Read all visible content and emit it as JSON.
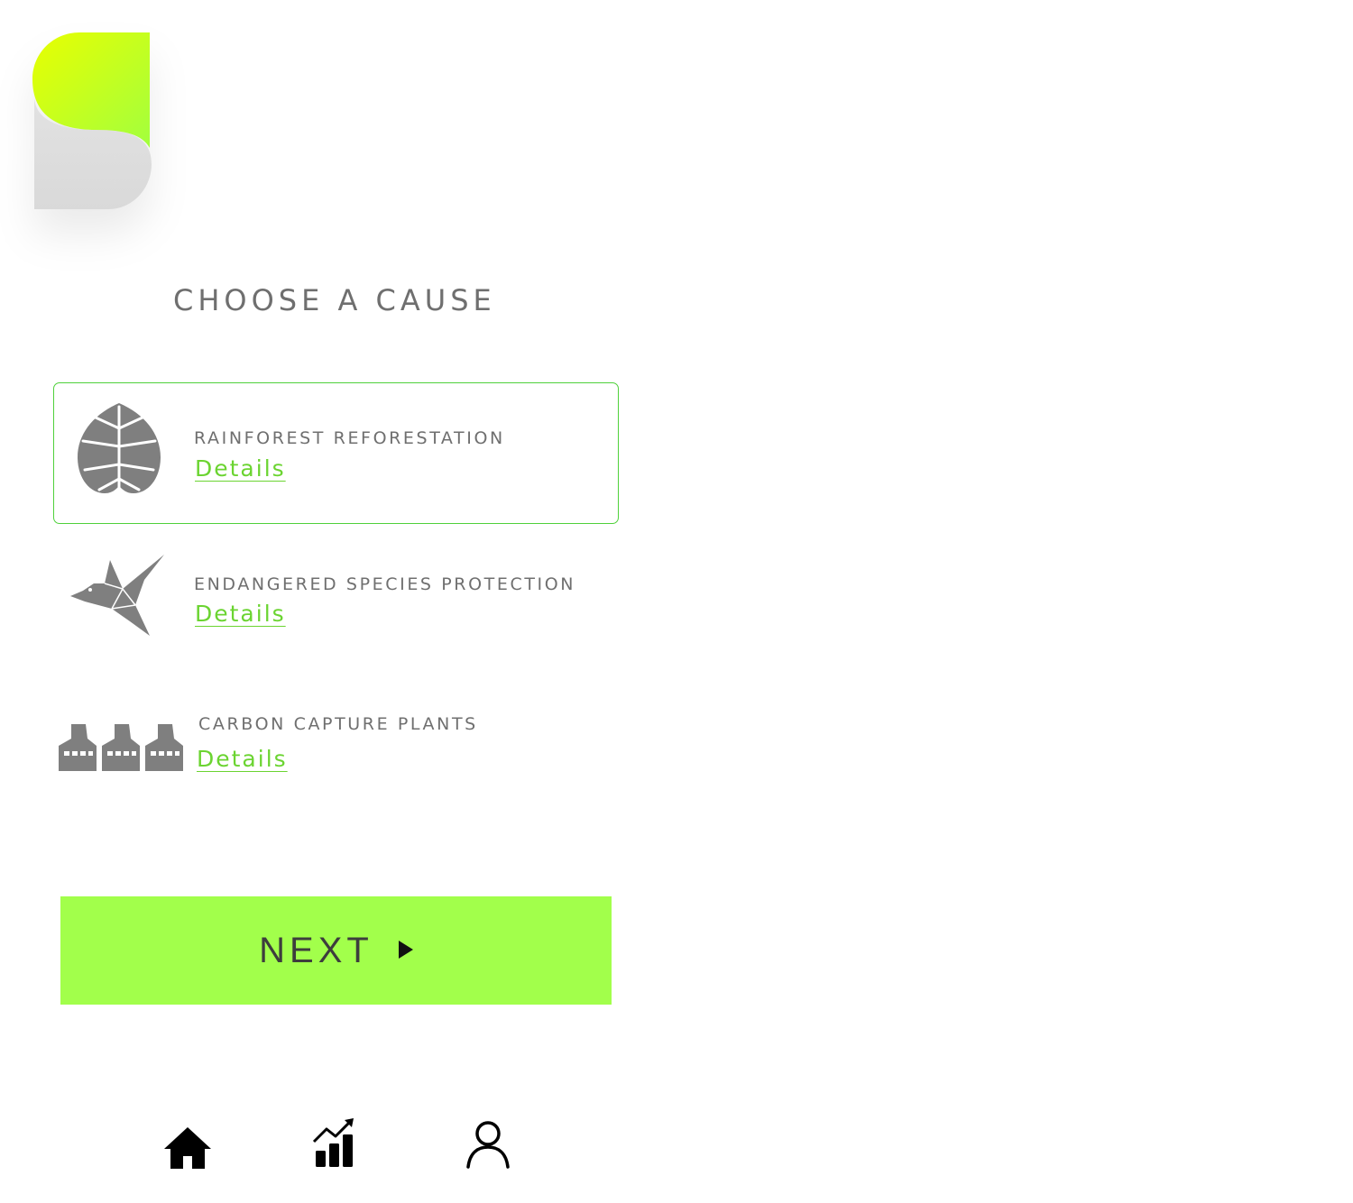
{
  "logo": {
    "icon": "brand-logo-icon",
    "gradient": [
      "#e5ff00",
      "#a6ff38"
    ],
    "base_color": "#dedede"
  },
  "page": {
    "title": "CHOOSE A CAUSE"
  },
  "causes": [
    {
      "name": "RAINFOREST REFORESTATION",
      "details_label": "Details",
      "icon": "leaf-icon",
      "selected": true
    },
    {
      "name": "ENDANGERED SPECIES PROTECTION",
      "details_label": "Details",
      "icon": "bird-icon",
      "selected": false
    },
    {
      "name": "CARBON CAPTURE PLANTS",
      "details_label": "Details",
      "icon": "factory-icon",
      "selected": false
    }
  ],
  "next_button": {
    "label": "NEXT",
    "icon": "play-arrow-icon"
  },
  "nav": [
    {
      "icon": "home-icon"
    },
    {
      "icon": "stats-icon"
    },
    {
      "icon": "profile-icon"
    }
  ],
  "colors": {
    "accent": "#a2ff4b",
    "link": "#6bd431",
    "selected_border": "#4fd13b",
    "text": "#6f6f6f",
    "icon": "#7f7f7f"
  }
}
